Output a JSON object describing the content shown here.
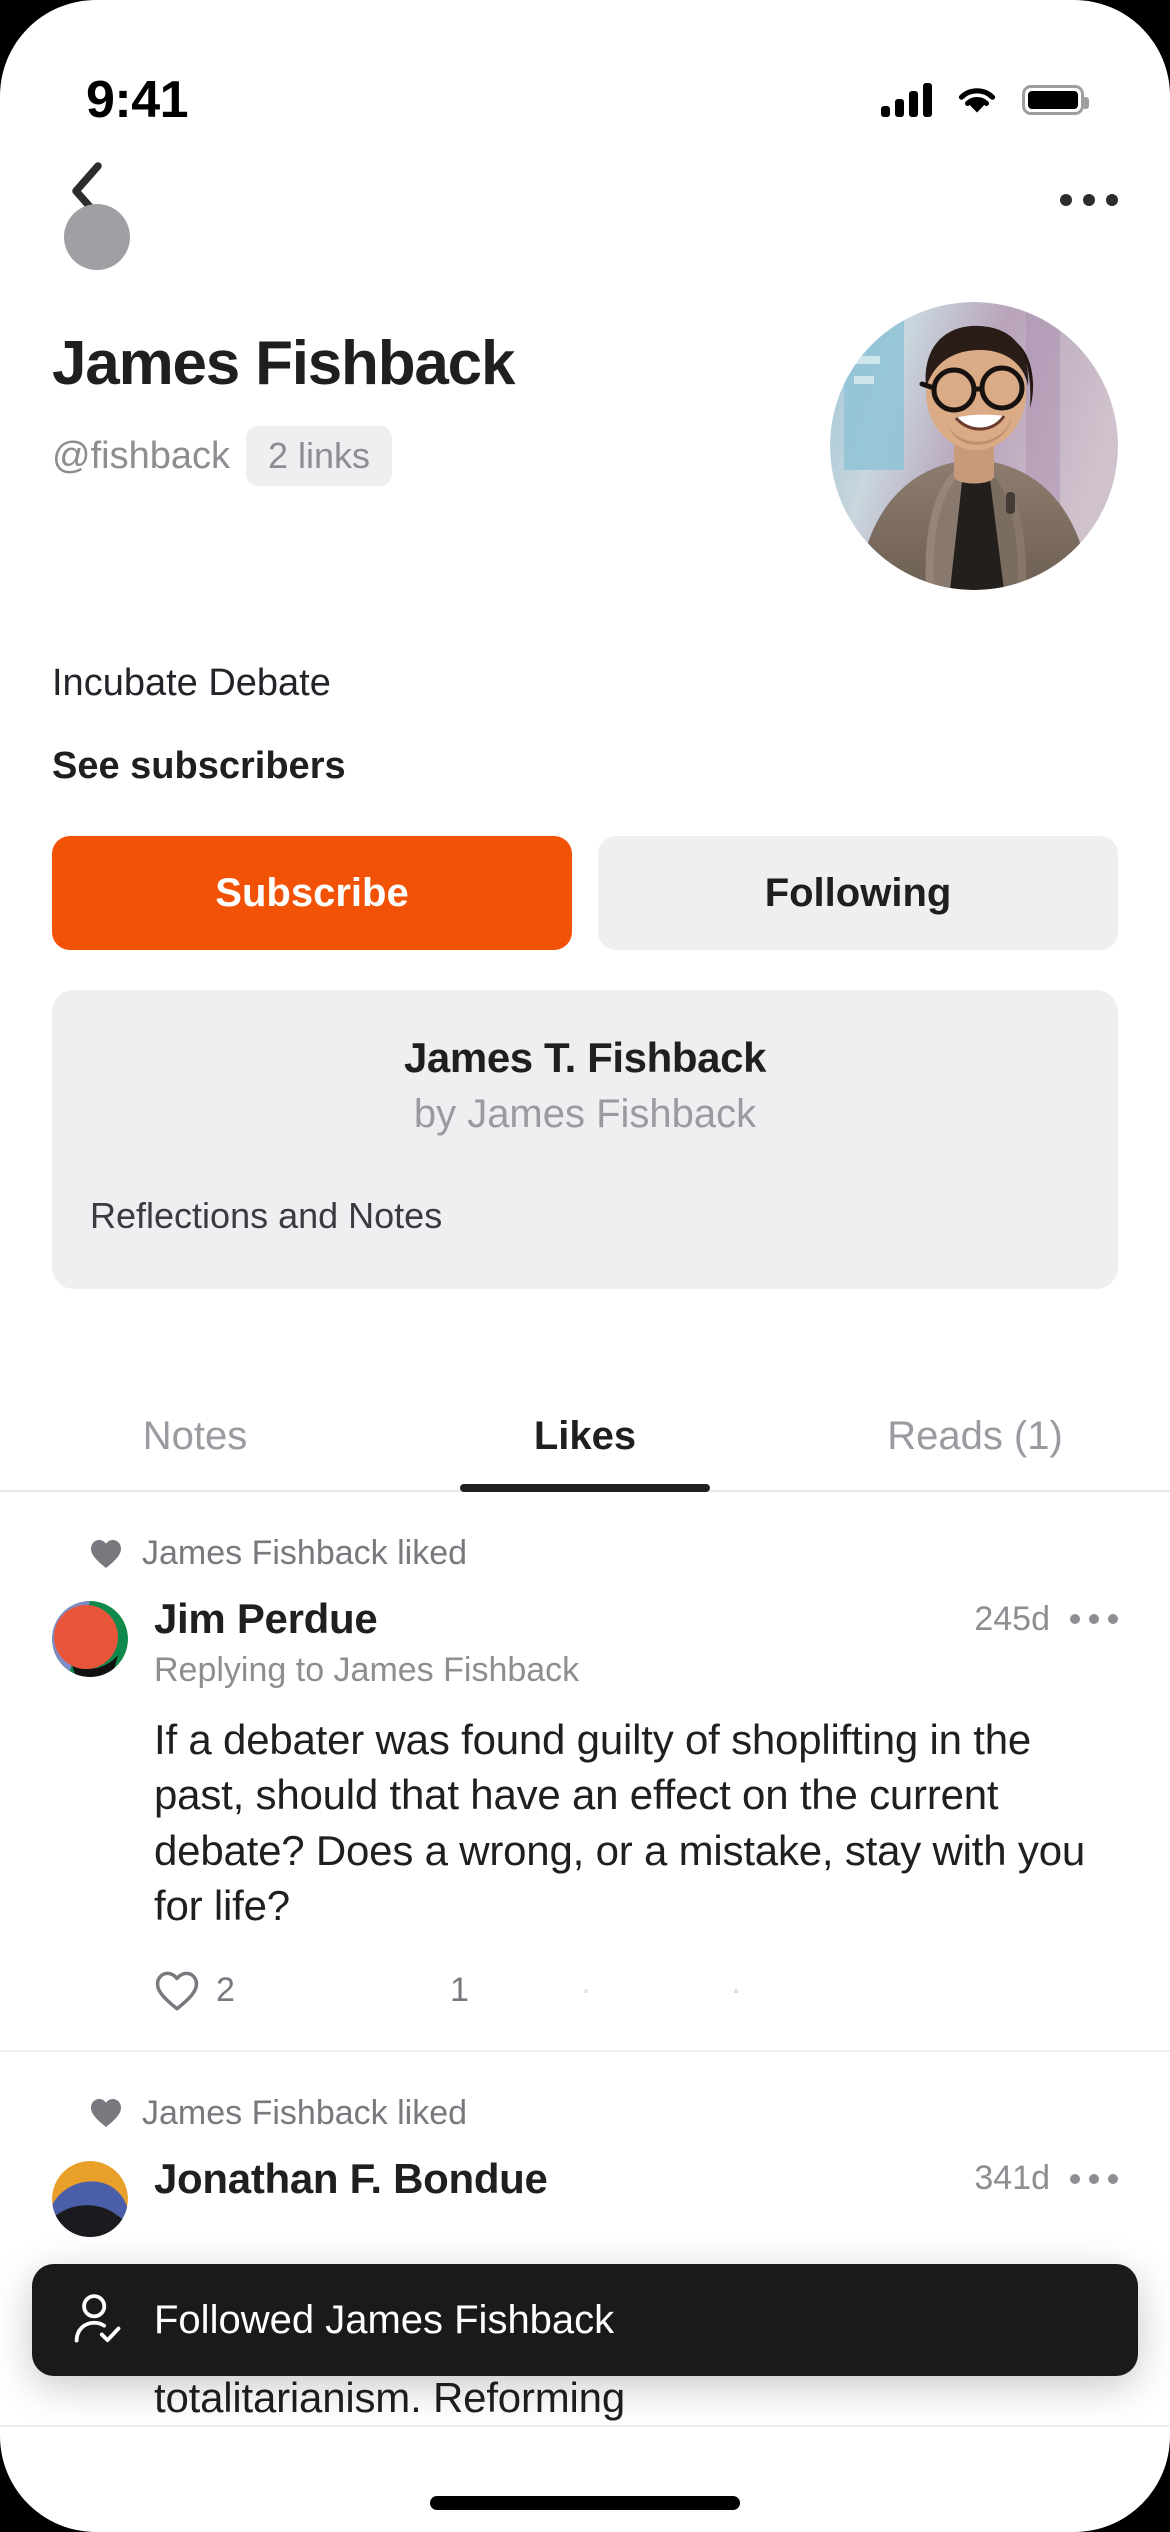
{
  "status_bar": {
    "time": "9:41",
    "signal_icon": "cellular-signal-icon",
    "wifi_icon": "wifi-icon",
    "battery_icon": "battery-icon"
  },
  "nav": {
    "back_icon": "back-chevron-icon",
    "more_icon": "more-options-icon"
  },
  "profile": {
    "name": "James Fishback",
    "handle": "@fishback",
    "links_badge": "2 links",
    "bio": "Incubate Debate",
    "see_subscribers": "See subscribers",
    "avatar_alt": "James Fishback profile photo"
  },
  "actions": {
    "subscribe_label": "Subscribe",
    "following_label": "Following"
  },
  "publication": {
    "title": "James T. Fishback",
    "byline": "by James Fishback",
    "subtitle": "Reflections and Notes"
  },
  "tabs": [
    {
      "label": "Notes",
      "active": false
    },
    {
      "label": "Likes",
      "active": true
    },
    {
      "label": "Reads (1)",
      "active": false
    }
  ],
  "feed": [
    {
      "liked_by": "James Fishback liked",
      "author": "Jim Perdue",
      "replying_to": "Replying to James Fishback",
      "time": "245d",
      "body": "If a debater was found guilty of shoplifting in the past, should that have an effect on the current debate? Does a wrong, or a mistake, stay with you for life?",
      "like_count": "2",
      "comment_count": "1",
      "restack_count": "",
      "share_count": ""
    },
    {
      "liked_by": "James Fishback liked",
      "author": "Jonathan F. Bondue",
      "replying_to": "",
      "time": "341d",
      "body": "This effort to start a new, parallel debate society should be a model now for what to do about this totalitarianism. Reforming",
      "like_count": "",
      "comment_count": "",
      "restack_count": "",
      "share_count": ""
    }
  ],
  "toast": {
    "icon": "person-check-icon",
    "message": "Followed James Fishback"
  },
  "colors": {
    "accent": "#F25205",
    "toast_bg": "#1A1A1A",
    "muted": "#8D8D92",
    "card_bg": "#EFEFF1"
  }
}
